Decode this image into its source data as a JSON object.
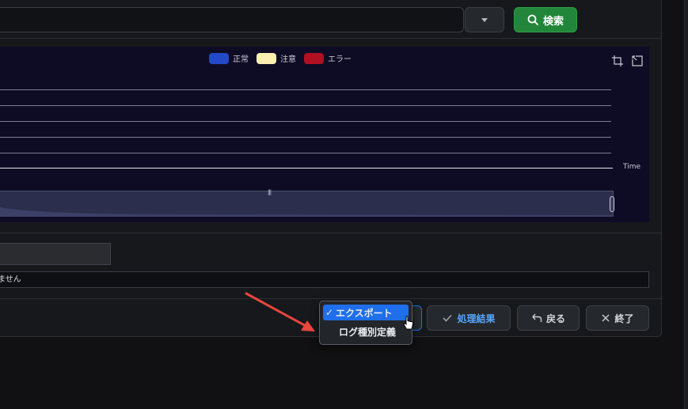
{
  "header": {
    "search_button_label": "検索",
    "search_input_value": ""
  },
  "chart": {
    "legend": [
      {
        "label": "正常",
        "color": "#2349c9"
      },
      {
        "label": "注意",
        "color": "#fcefb0"
      },
      {
        "label": "エラー",
        "color": "#b01021"
      }
    ],
    "x_axis_label": "Time",
    "background": "#0e0c25"
  },
  "status": {
    "message_fragment": "ません"
  },
  "footer": {
    "results_button_label": "処理結果",
    "back_button_label": "戻る",
    "quit_button_label": "終了"
  },
  "dropdown_menu": {
    "items": [
      {
        "label": "エクスポート",
        "selected": true
      },
      {
        "label": "ログ種別定義",
        "selected": false
      }
    ]
  },
  "colors": {
    "accent": "#1f6feb",
    "primary_action": "#22863a",
    "link": "#58a6ff"
  }
}
